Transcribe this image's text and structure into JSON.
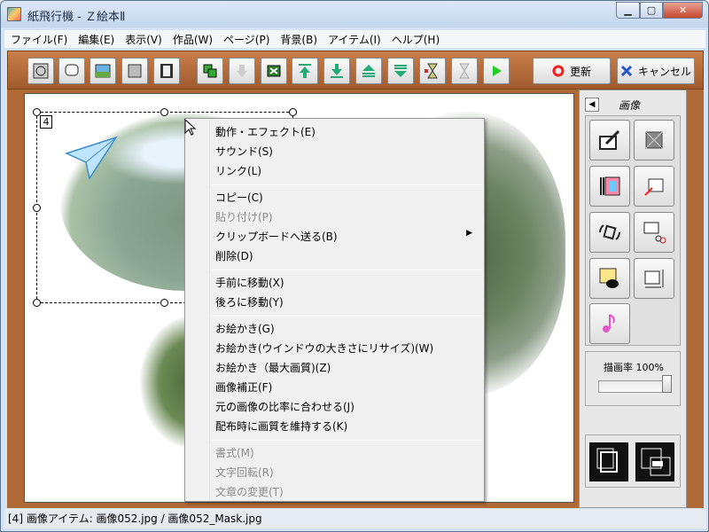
{
  "window": {
    "title": "紙飛行機 - Ｚ絵本Ⅱ",
    "min_glyph": "▁",
    "max_glyph": "▢",
    "close_glyph": "✕"
  },
  "menubar": {
    "items": [
      "ファイル(F)",
      "編集(E)",
      "表示(V)",
      "作品(W)",
      "ページ(P)",
      "背景(B)",
      "アイテム(I)",
      "ヘルプ(H)"
    ]
  },
  "toolbar": {
    "update_label": "更新",
    "cancel_label": "キャンセル"
  },
  "canvas": {
    "item_number": "4"
  },
  "context_menu": {
    "items": [
      {
        "label": "動作・エフェクト(E)",
        "enabled": true
      },
      {
        "label": "サウンド(S)",
        "enabled": true
      },
      {
        "label": "リンク(L)",
        "enabled": true
      },
      {
        "label": "コピー(C)",
        "enabled": true
      },
      {
        "label": "貼り付け(P)",
        "enabled": false
      },
      {
        "label": "クリップボードへ送る(B)",
        "enabled": true,
        "submenu": true
      },
      {
        "label": "削除(D)",
        "enabled": true
      },
      {
        "label": "手前に移動(X)",
        "enabled": true
      },
      {
        "label": "後ろに移動(Y)",
        "enabled": true
      },
      {
        "label": "お絵かき(G)",
        "enabled": true
      },
      {
        "label": "お絵かき(ウインドウの大きさにリサイズ)(W)",
        "enabled": true
      },
      {
        "label": "お絵かき（最大画質)(Z)",
        "enabled": true
      },
      {
        "label": "画像補正(F)",
        "enabled": true
      },
      {
        "label": "元の画像の比率に合わせる(J)",
        "enabled": true
      },
      {
        "label": "配布時に画質を維持する(K)",
        "enabled": true
      },
      {
        "label": "書式(M)",
        "enabled": false
      },
      {
        "label": "文字回転(R)",
        "enabled": false
      },
      {
        "label": "文章の変更(T)",
        "enabled": false
      }
    ]
  },
  "right_panel": {
    "title": "画像",
    "rate_label": "描画率 100%",
    "rate_value": 100
  },
  "statusbar": {
    "text": "[4] 画像アイテム: 画像052.jpg / 画像052_Mask.jpg"
  }
}
